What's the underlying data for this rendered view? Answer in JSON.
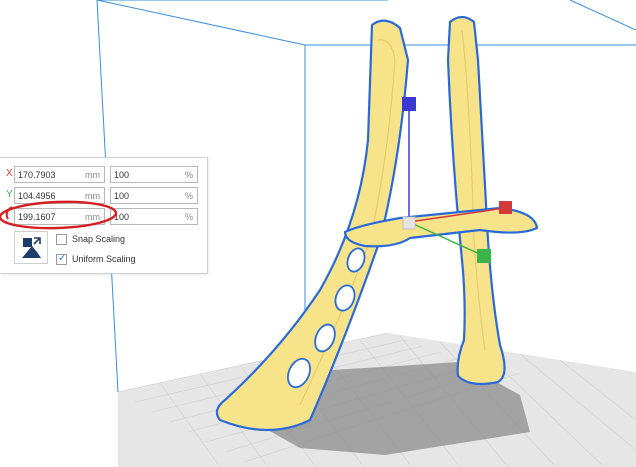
{
  "colors": {
    "model_fill": "#f7e38a",
    "model_outline": "#2a6ad8",
    "axis_x": "#d23a3a",
    "axis_y": "#3cb34a",
    "axis_z": "#3a3ad2",
    "bounds_line": "#3a8fd8",
    "highlight": "#d42020",
    "build_plate": "#e6e6e6",
    "shadow": "#8c8c8c"
  },
  "scale_panel": {
    "rows": [
      {
        "axis": "X",
        "axis_color": "#d23a3a",
        "size": "170.7903",
        "size_unit": "mm",
        "percent": "100",
        "percent_unit": "%"
      },
      {
        "axis": "Y",
        "axis_color": "#3cb34a",
        "size": "104.4956",
        "size_unit": "mm",
        "percent": "100",
        "percent_unit": "%"
      },
      {
        "axis": "Z",
        "axis_color": "#3a3ad2",
        "size": "199.1607",
        "size_unit": "mm",
        "percent": "100",
        "percent_unit": "%"
      }
    ],
    "tool_icon": "scale-tool-icon",
    "snap_scaling": {
      "label": "Snap Scaling",
      "checked": false
    },
    "uniform_scaling": {
      "label": "Uniform Scaling",
      "checked": true
    }
  }
}
